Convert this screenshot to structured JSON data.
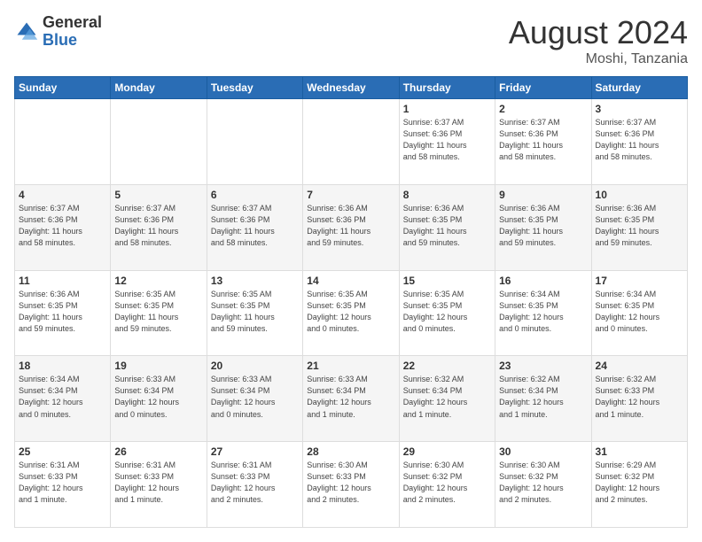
{
  "header": {
    "logo_general": "General",
    "logo_blue": "Blue",
    "month_year": "August 2024",
    "location": "Moshi, Tanzania"
  },
  "days_of_week": [
    "Sunday",
    "Monday",
    "Tuesday",
    "Wednesday",
    "Thursday",
    "Friday",
    "Saturday"
  ],
  "weeks": [
    [
      {
        "day": "",
        "info": ""
      },
      {
        "day": "",
        "info": ""
      },
      {
        "day": "",
        "info": ""
      },
      {
        "day": "",
        "info": ""
      },
      {
        "day": "1",
        "info": "Sunrise: 6:37 AM\nSunset: 6:36 PM\nDaylight: 11 hours\nand 58 minutes."
      },
      {
        "day": "2",
        "info": "Sunrise: 6:37 AM\nSunset: 6:36 PM\nDaylight: 11 hours\nand 58 minutes."
      },
      {
        "day": "3",
        "info": "Sunrise: 6:37 AM\nSunset: 6:36 PM\nDaylight: 11 hours\nand 58 minutes."
      }
    ],
    [
      {
        "day": "4",
        "info": "Sunrise: 6:37 AM\nSunset: 6:36 PM\nDaylight: 11 hours\nand 58 minutes."
      },
      {
        "day": "5",
        "info": "Sunrise: 6:37 AM\nSunset: 6:36 PM\nDaylight: 11 hours\nand 58 minutes."
      },
      {
        "day": "6",
        "info": "Sunrise: 6:37 AM\nSunset: 6:36 PM\nDaylight: 11 hours\nand 58 minutes."
      },
      {
        "day": "7",
        "info": "Sunrise: 6:36 AM\nSunset: 6:36 PM\nDaylight: 11 hours\nand 59 minutes."
      },
      {
        "day": "8",
        "info": "Sunrise: 6:36 AM\nSunset: 6:35 PM\nDaylight: 11 hours\nand 59 minutes."
      },
      {
        "day": "9",
        "info": "Sunrise: 6:36 AM\nSunset: 6:35 PM\nDaylight: 11 hours\nand 59 minutes."
      },
      {
        "day": "10",
        "info": "Sunrise: 6:36 AM\nSunset: 6:35 PM\nDaylight: 11 hours\nand 59 minutes."
      }
    ],
    [
      {
        "day": "11",
        "info": "Sunrise: 6:36 AM\nSunset: 6:35 PM\nDaylight: 11 hours\nand 59 minutes."
      },
      {
        "day": "12",
        "info": "Sunrise: 6:35 AM\nSunset: 6:35 PM\nDaylight: 11 hours\nand 59 minutes."
      },
      {
        "day": "13",
        "info": "Sunrise: 6:35 AM\nSunset: 6:35 PM\nDaylight: 11 hours\nand 59 minutes."
      },
      {
        "day": "14",
        "info": "Sunrise: 6:35 AM\nSunset: 6:35 PM\nDaylight: 12 hours\nand 0 minutes."
      },
      {
        "day": "15",
        "info": "Sunrise: 6:35 AM\nSunset: 6:35 PM\nDaylight: 12 hours\nand 0 minutes."
      },
      {
        "day": "16",
        "info": "Sunrise: 6:34 AM\nSunset: 6:35 PM\nDaylight: 12 hours\nand 0 minutes."
      },
      {
        "day": "17",
        "info": "Sunrise: 6:34 AM\nSunset: 6:35 PM\nDaylight: 12 hours\nand 0 minutes."
      }
    ],
    [
      {
        "day": "18",
        "info": "Sunrise: 6:34 AM\nSunset: 6:34 PM\nDaylight: 12 hours\nand 0 minutes."
      },
      {
        "day": "19",
        "info": "Sunrise: 6:33 AM\nSunset: 6:34 PM\nDaylight: 12 hours\nand 0 minutes."
      },
      {
        "day": "20",
        "info": "Sunrise: 6:33 AM\nSunset: 6:34 PM\nDaylight: 12 hours\nand 0 minutes."
      },
      {
        "day": "21",
        "info": "Sunrise: 6:33 AM\nSunset: 6:34 PM\nDaylight: 12 hours\nand 1 minute."
      },
      {
        "day": "22",
        "info": "Sunrise: 6:32 AM\nSunset: 6:34 PM\nDaylight: 12 hours\nand 1 minute."
      },
      {
        "day": "23",
        "info": "Sunrise: 6:32 AM\nSunset: 6:34 PM\nDaylight: 12 hours\nand 1 minute."
      },
      {
        "day": "24",
        "info": "Sunrise: 6:32 AM\nSunset: 6:33 PM\nDaylight: 12 hours\nand 1 minute."
      }
    ],
    [
      {
        "day": "25",
        "info": "Sunrise: 6:31 AM\nSunset: 6:33 PM\nDaylight: 12 hours\nand 1 minute."
      },
      {
        "day": "26",
        "info": "Sunrise: 6:31 AM\nSunset: 6:33 PM\nDaylight: 12 hours\nand 1 minute."
      },
      {
        "day": "27",
        "info": "Sunrise: 6:31 AM\nSunset: 6:33 PM\nDaylight: 12 hours\nand 2 minutes."
      },
      {
        "day": "28",
        "info": "Sunrise: 6:30 AM\nSunset: 6:33 PM\nDaylight: 12 hours\nand 2 minutes."
      },
      {
        "day": "29",
        "info": "Sunrise: 6:30 AM\nSunset: 6:32 PM\nDaylight: 12 hours\nand 2 minutes."
      },
      {
        "day": "30",
        "info": "Sunrise: 6:30 AM\nSunset: 6:32 PM\nDaylight: 12 hours\nand 2 minutes."
      },
      {
        "day": "31",
        "info": "Sunrise: 6:29 AM\nSunset: 6:32 PM\nDaylight: 12 hours\nand 2 minutes."
      }
    ]
  ]
}
